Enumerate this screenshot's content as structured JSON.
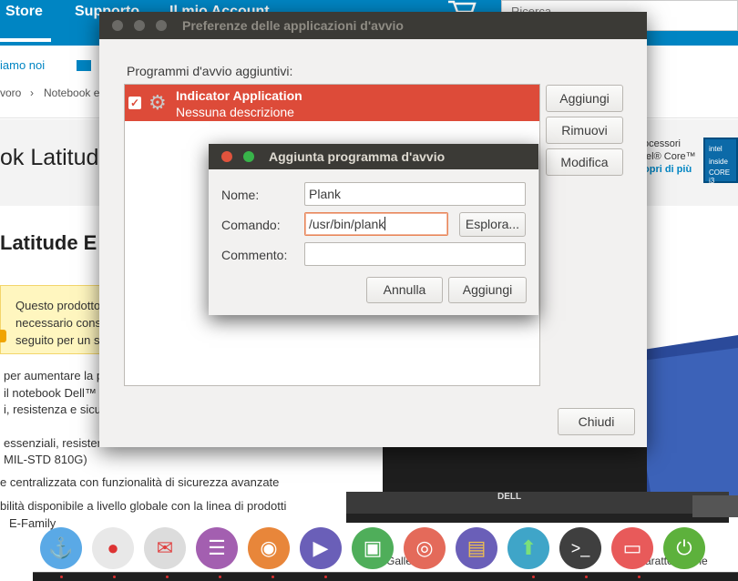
{
  "background_page": {
    "nav": {
      "store": "Store",
      "support": "Supporto",
      "account": "Il mio Account"
    },
    "search_placeholder": "Ricerca",
    "contact": "iamo noi",
    "breadcrumb": [
      "voro",
      "Notebook e"
    ],
    "hero_title": "ok Latitude",
    "processor_text": [
      "ocessori",
      "tel® Core™",
      "opri di più"
    ],
    "intel_badge": [
      "intel",
      "inside",
      "CORE i3"
    ],
    "heading": "Latitude E",
    "notice": [
      "Questo prodotto",
      "necessario cons",
      "seguito per un s"
    ],
    "body_lines": [
      "per aumentare la p",
      "il notebook Dell™ L",
      "i, resistenza e sicu",
      "essenziali, resister",
      "MIL-STD 810G)",
      "e centralizzata con funzionalità di sicurezza avanzate",
      "bilità disponibile a livello globale con la linea di prodotti",
      "E-Family"
    ],
    "laptop_brand": "DELL",
    "footer_left": "Galler",
    "footer_right": "aratteristiche"
  },
  "main_dialog": {
    "title": "Preferenze delle applicazioni d'avvio",
    "list_label": "Programmi d'avvio aggiuntivi:",
    "items": [
      {
        "name": "Indicator Application",
        "description": "Nessuna descrizione",
        "checked": true
      }
    ],
    "buttons": {
      "add": "Aggiungi",
      "remove": "Rimuovi",
      "edit": "Modifica",
      "close": "Chiudi"
    }
  },
  "add_dialog": {
    "title": "Aggiunta programma d'avvio",
    "name_label": "Nome:",
    "name_value": "Plank",
    "command_label": "Comando:",
    "command_value": "/usr/bin/plank",
    "browse": "Esplora...",
    "comment_label": "Commento:",
    "comment_value": "",
    "cancel": "Annulla",
    "add": "Aggiungi"
  },
  "dock": [
    {
      "name": "anchor-icon",
      "color": "#5aa9e6"
    },
    {
      "name": "chrome-icon",
      "color": "#e8e8e8"
    },
    {
      "name": "mail-icon",
      "color": "#dcdcdc"
    },
    {
      "name": "document-icon",
      "color": "#a35fb0"
    },
    {
      "name": "speaker-icon",
      "color": "#e8863a"
    },
    {
      "name": "video-icon",
      "color": "#6a5fb8"
    },
    {
      "name": "image-viewer-icon",
      "color": "#4fae5a"
    },
    {
      "name": "camera-icon",
      "color": "#e46a5a"
    },
    {
      "name": "files-icon",
      "color": "#6a5fb8"
    },
    {
      "name": "update-icon",
      "color": "#3fa5c8"
    },
    {
      "name": "terminal-icon",
      "color": "#3f3f3f"
    },
    {
      "name": "slides-icon",
      "color": "#e85a5a"
    },
    {
      "name": "power-icon",
      "color": "#5db13c"
    }
  ],
  "colors": {
    "accent": "#dd4b39",
    "titlebar": "#3b3a36",
    "dell_blue": "#0085c3"
  }
}
